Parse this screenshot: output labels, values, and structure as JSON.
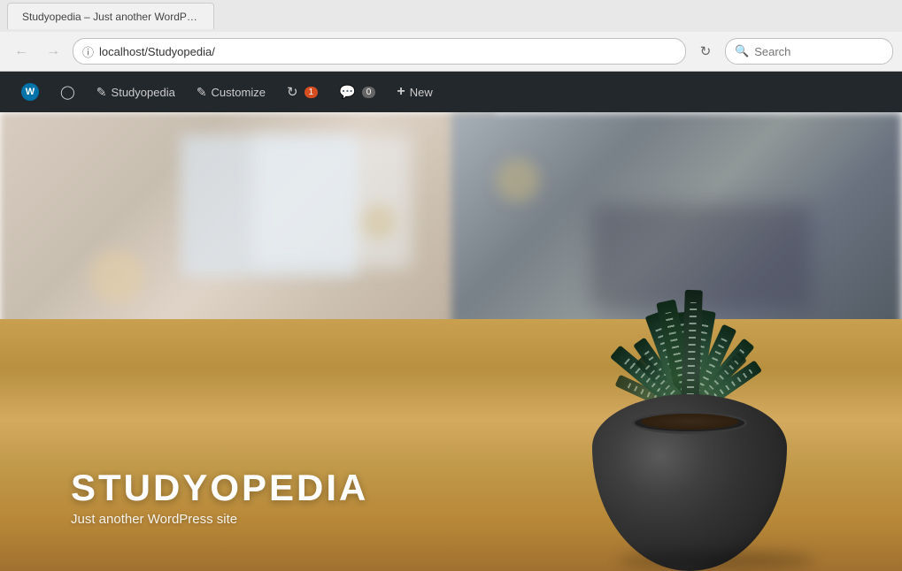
{
  "browser": {
    "url": "localhost/Studyopedia/",
    "search_placeholder": "Search",
    "back_button_label": "←",
    "forward_button_label": "→",
    "reload_label": "↻",
    "tab_label": "Studyopedia – Just another WordPress site"
  },
  "admin_bar": {
    "wp_logo_label": "W",
    "site_name": "Studyopedia",
    "customize_label": "Customize",
    "updates_count": "1",
    "comments_count": "0",
    "new_label": "New"
  },
  "hero": {
    "site_title": "STUDYOPEDIA",
    "site_tagline": "Just another WordPress site"
  }
}
